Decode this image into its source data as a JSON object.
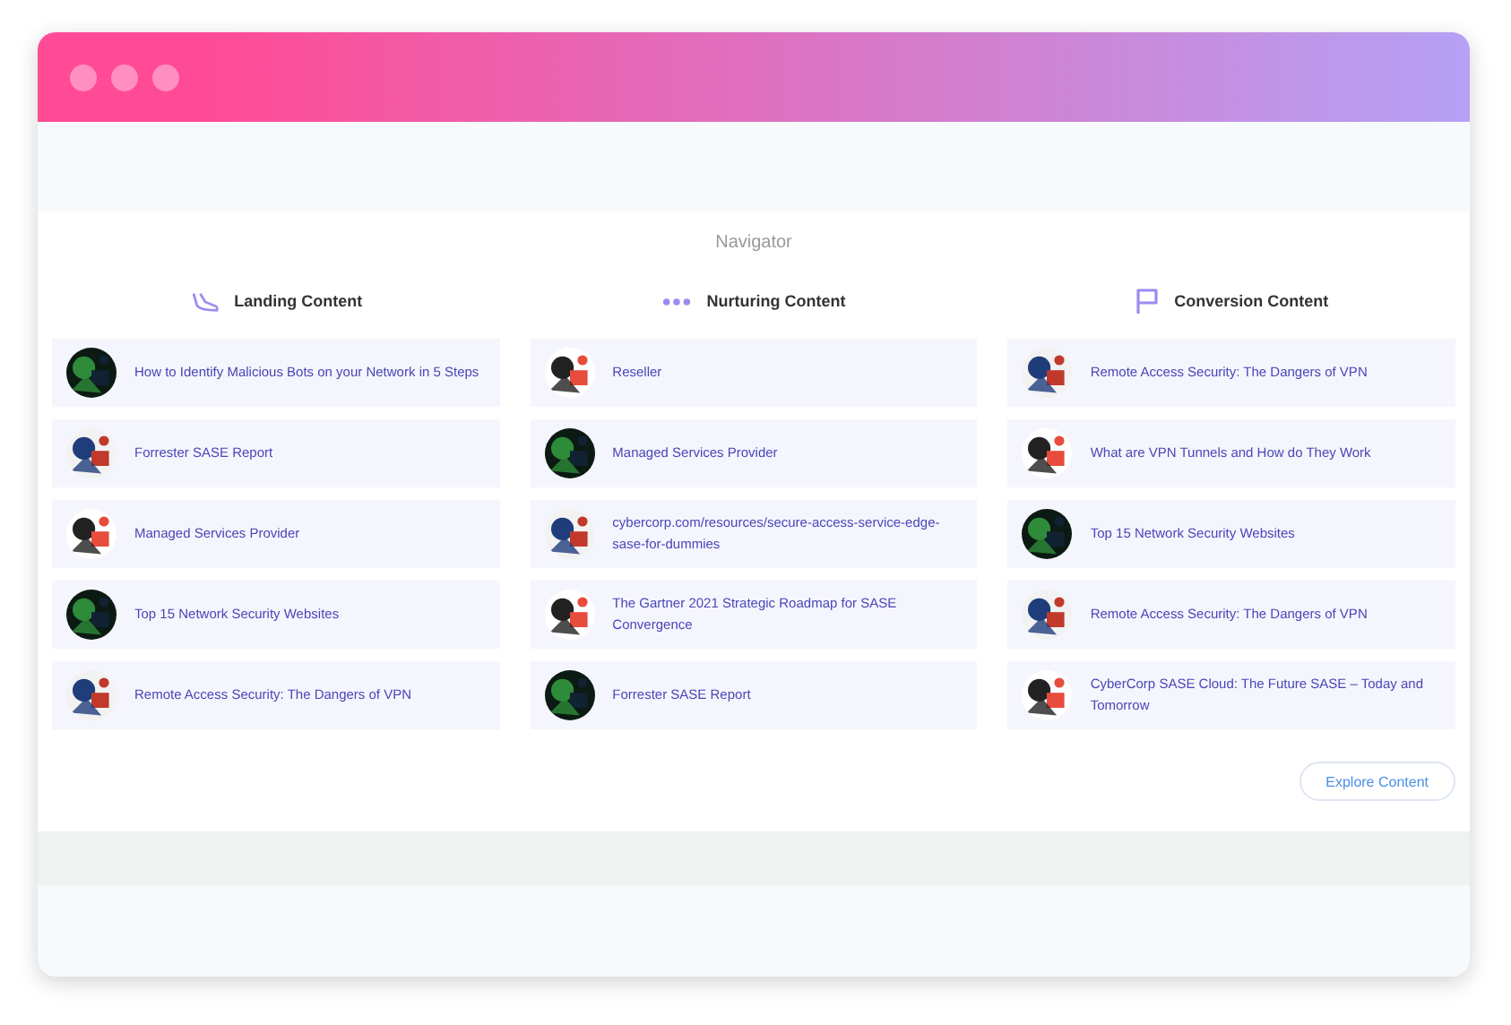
{
  "navigator": {
    "title": "Navigator",
    "columns": [
      {
        "title": "Landing Content",
        "kind": "shoe",
        "items": [
          {
            "title": "How to Identify Malicious Bots on your Network in 5 Steps"
          },
          {
            "title": "Forrester SASE Report"
          },
          {
            "title": "Managed Services Provider"
          },
          {
            "title": "Top 15 Network Security Websites"
          },
          {
            "title": "Remote Access Security: The Dangers of VPN"
          }
        ]
      },
      {
        "title": "Nurturing Content",
        "kind": "dots",
        "items": [
          {
            "title": "Reseller"
          },
          {
            "title": "Managed Services Provider"
          },
          {
            "title": "cybercorp.com/resources/secure-access-service-edge-sase-for-dummies"
          },
          {
            "title": "The Gartner 2021 Strategic Roadmap for SASE Convergence"
          },
          {
            "title": "Forrester SASE Report"
          }
        ]
      },
      {
        "title": "Conversion Content",
        "kind": "flag",
        "items": [
          {
            "title": "Remote Access Security: The Dangers of VPN"
          },
          {
            "title": "What are VPN Tunnels and How do They Work"
          },
          {
            "title": "Top 15 Network Security Websites"
          },
          {
            "title": "Remote Access Security: The Dangers of VPN"
          },
          {
            "title": "CyberCorp SASE Cloud: The Future SASE – Today and Tomorrow"
          }
        ]
      }
    ],
    "button": "Explore Content"
  }
}
